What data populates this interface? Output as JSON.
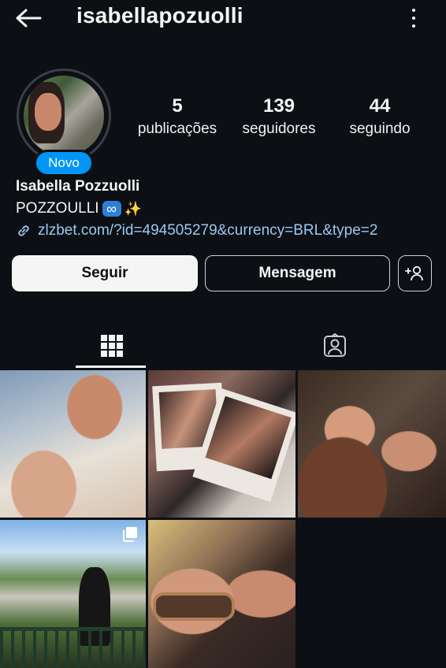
{
  "header": {
    "username": "isabellapozuolli"
  },
  "profile": {
    "badge": "Novo",
    "full_name": "Isabella Pozzuolli",
    "bio_text": "POZZOULLI",
    "bio_emoji_infinity": "∞",
    "bio_emoji_sparkles": "✨",
    "link": "zlzbet.com/?id=494505279&currency=BRL&type=2"
  },
  "stats": [
    {
      "value": "5",
      "label": "publicações"
    },
    {
      "value": "139",
      "label": "seguidores"
    },
    {
      "value": "44",
      "label": "seguindo"
    }
  ],
  "actions": {
    "follow": "Seguir",
    "message": "Mensagem"
  },
  "tabs": [
    {
      "icon": "grid-icon",
      "active": true
    },
    {
      "icon": "tagged-icon",
      "active": false
    }
  ],
  "posts": [
    {
      "multi": false
    },
    {
      "multi": false
    },
    {
      "multi": false
    },
    {
      "multi": true
    },
    {
      "multi": false
    }
  ],
  "colors": {
    "background": "#0c1014",
    "badge_blue": "#0095f6",
    "link": "#9ec7f2"
  }
}
